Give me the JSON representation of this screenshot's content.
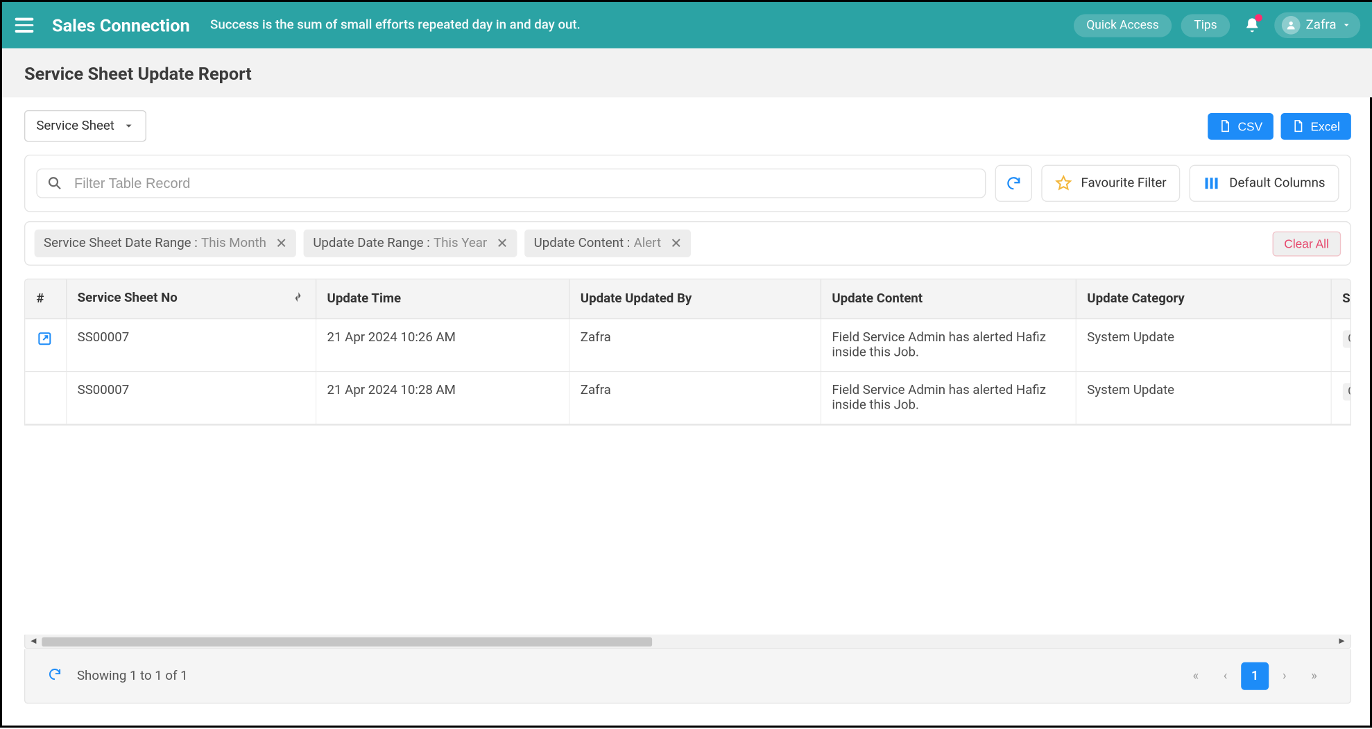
{
  "header": {
    "brand": "Sales Connection",
    "tagline": "Success is the sum of small efforts repeated day in and day out.",
    "quick_access": "Quick Access",
    "tips": "Tips",
    "user": "Zafra"
  },
  "page": {
    "title": "Service Sheet Update Report",
    "dropdown": "Service Sheet",
    "export_csv": "CSV",
    "export_excel": "Excel"
  },
  "filter_bar": {
    "search_placeholder": "Filter Table Record",
    "favourite": "Favourite Filter",
    "default_cols": "Default Columns"
  },
  "tags": [
    {
      "label": "Service Sheet Date Range :",
      "value": "This Month"
    },
    {
      "label": "Update Date Range :",
      "value": "This Year"
    },
    {
      "label": "Update Content :",
      "value": "Alert"
    }
  ],
  "clear_all": "Clear All",
  "columns": {
    "num": "#",
    "sheet_no": "Service Sheet No",
    "update_time": "Update Time",
    "updated_by": "Update Updated By",
    "content": "Update Content",
    "category": "Update Category",
    "service": "Serv"
  },
  "rows": [
    {
      "sheet_no": "SS00007",
      "update_time": "21 Apr 2024 10:26 AM",
      "updated_by": "Zafra",
      "content": "Field Service Admin has alerted Hafiz inside this Job.",
      "category": "System Update",
      "service": "Cre"
    },
    {
      "sheet_no": "SS00007",
      "update_time": "21 Apr 2024 10:28 AM",
      "updated_by": "Zafra",
      "content": "Field Service Admin has alerted Hafiz inside this Job.",
      "category": "System Update",
      "service": "Cre"
    }
  ],
  "footer": {
    "showing": "Showing 1 to 1 of 1",
    "page": "1"
  }
}
